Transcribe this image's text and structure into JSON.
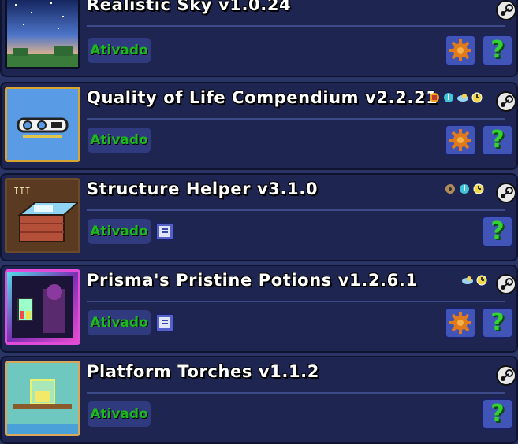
{
  "mods": [
    {
      "title": "Realistic Sky v1.0.24",
      "status": "Ativado",
      "has_config": true,
      "has_help": true,
      "thumb": "sky"
    },
    {
      "title": "Quality of Life Compendium v2.2.21",
      "status": "Ativado",
      "has_config": true,
      "has_help": true,
      "thumb": "qol"
    },
    {
      "title": "Structure Helper v3.1.0",
      "status": "Ativado",
      "has_config": false,
      "has_help": true,
      "thumb": "structure"
    },
    {
      "title": "Prisma's Pristine Potions v1.2.6.1",
      "status": "Ativado",
      "has_config": true,
      "has_help": true,
      "thumb": "potions"
    },
    {
      "title": "Platform Torches v1.1.2",
      "status": "Ativado",
      "has_config": false,
      "has_help": true,
      "thumb": "torches"
    }
  ],
  "icons": {
    "steam": "steam-icon",
    "config": "gear-icon",
    "help": "question-mark-icon",
    "note": "config-note-icon"
  },
  "colors": {
    "row_bg": "#1e2550",
    "status_text": "#1db81d",
    "button_bg": "#4154b8",
    "help_glyph": "#32d232"
  },
  "help_glyph": "?"
}
